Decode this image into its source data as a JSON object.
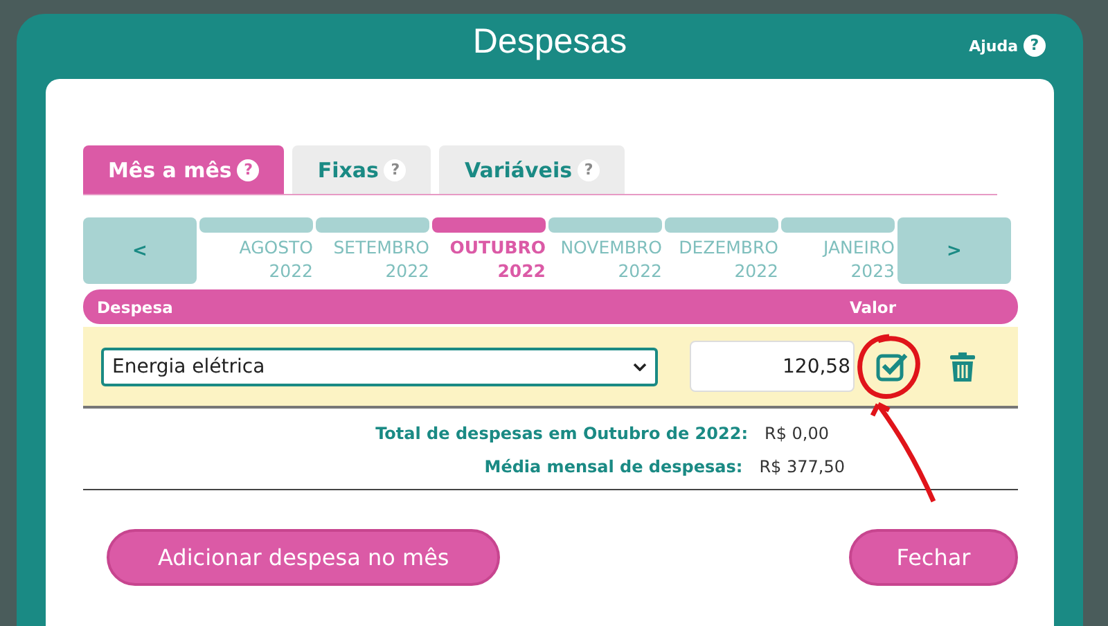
{
  "dialog": {
    "title": "Despesas",
    "help_label": "Ajuda",
    "help_icon": "?"
  },
  "tabs": [
    {
      "label": "Mês a mês",
      "help_icon": "?",
      "selected": true
    },
    {
      "label": "Fixas",
      "help_icon": "?",
      "selected": false
    },
    {
      "label": "Variáveis",
      "help_icon": "?",
      "selected": false
    }
  ],
  "month_nav": {
    "prev": "<",
    "next": ">"
  },
  "months": [
    {
      "month": "AGOSTO",
      "year": "2022",
      "selected": false
    },
    {
      "month": "SETEMBRO",
      "year": "2022",
      "selected": false
    },
    {
      "month": "OUTUBRO",
      "year": "2022",
      "selected": true
    },
    {
      "month": "NOVEMBRO",
      "year": "2022",
      "selected": false
    },
    {
      "month": "DEZEMBRO",
      "year": "2022",
      "selected": false
    },
    {
      "month": "JANEIRO",
      "year": "2023",
      "selected": false
    }
  ],
  "table": {
    "columns": [
      "Despesa",
      "Valor"
    ],
    "rows": [
      {
        "expense": "Energia elétrica",
        "value": "120,58"
      }
    ]
  },
  "totals": [
    {
      "label": "Total de despesas em Outubro de 2022:",
      "value": "R$ 0,00"
    },
    {
      "label": "Média mensal de despesas:",
      "value": "R$ 377,50"
    }
  ],
  "buttons": {
    "add": "Adicionar despesa no mês",
    "close": "Fechar"
  }
}
